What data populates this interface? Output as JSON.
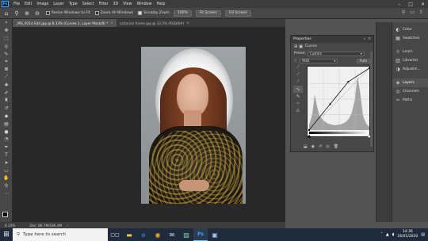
{
  "menubar": {
    "app_logo": "Ps",
    "items": [
      "File",
      "Edit",
      "Image",
      "Layer",
      "Type",
      "Select",
      "Filter",
      "3D",
      "View",
      "Window",
      "Help"
    ],
    "window_controls": [
      "–",
      "□",
      "✕"
    ]
  },
  "options": {
    "resize_windows": "Resize Windows to Fit",
    "zoom_all": "Zoom All Windows",
    "scrubby_zoom": "Scrubby Zoom",
    "zoom_value": "100%",
    "fit_screen": "Fit Screen",
    "fill_screen": "Fill Screen"
  },
  "tabs": [
    {
      "label": "_MG_9214 Edit.jpg @ 8.33% (Curves 2, Layer Mask/8) *",
      "active": true
    },
    {
      "label": "victorian frame.jpg @ 33.3% (RGB/8#)",
      "active": false
    }
  ],
  "status": {
    "zoom": "8.33%",
    "doc": "Doc: 86.7M/186.4M"
  },
  "properties": {
    "title": "Properties",
    "adjustment": "Curves",
    "preset_label": "Preset:",
    "preset_value": "Custom",
    "channel": "RGB",
    "auto": "Auto"
  },
  "dock": {
    "group1": [
      "Color",
      "Swatches"
    ],
    "group2": [
      "Learn",
      "Libraries",
      "Adjustm..."
    ],
    "group3": [
      "Layers",
      "Channels",
      "Paths"
    ]
  },
  "taskbar": {
    "search_placeholder": "Type here to search",
    "time": "14:36",
    "date": "16/01/2020"
  },
  "curve": {
    "points": [
      [
        0,
        0
      ],
      [
        0.35,
        0.42
      ],
      [
        0.65,
        0.78
      ],
      [
        1,
        1
      ]
    ]
  },
  "colors": {
    "accent": "#31a8ff",
    "foreground_swatch": "#000000",
    "background_swatch": "#ffffff"
  }
}
